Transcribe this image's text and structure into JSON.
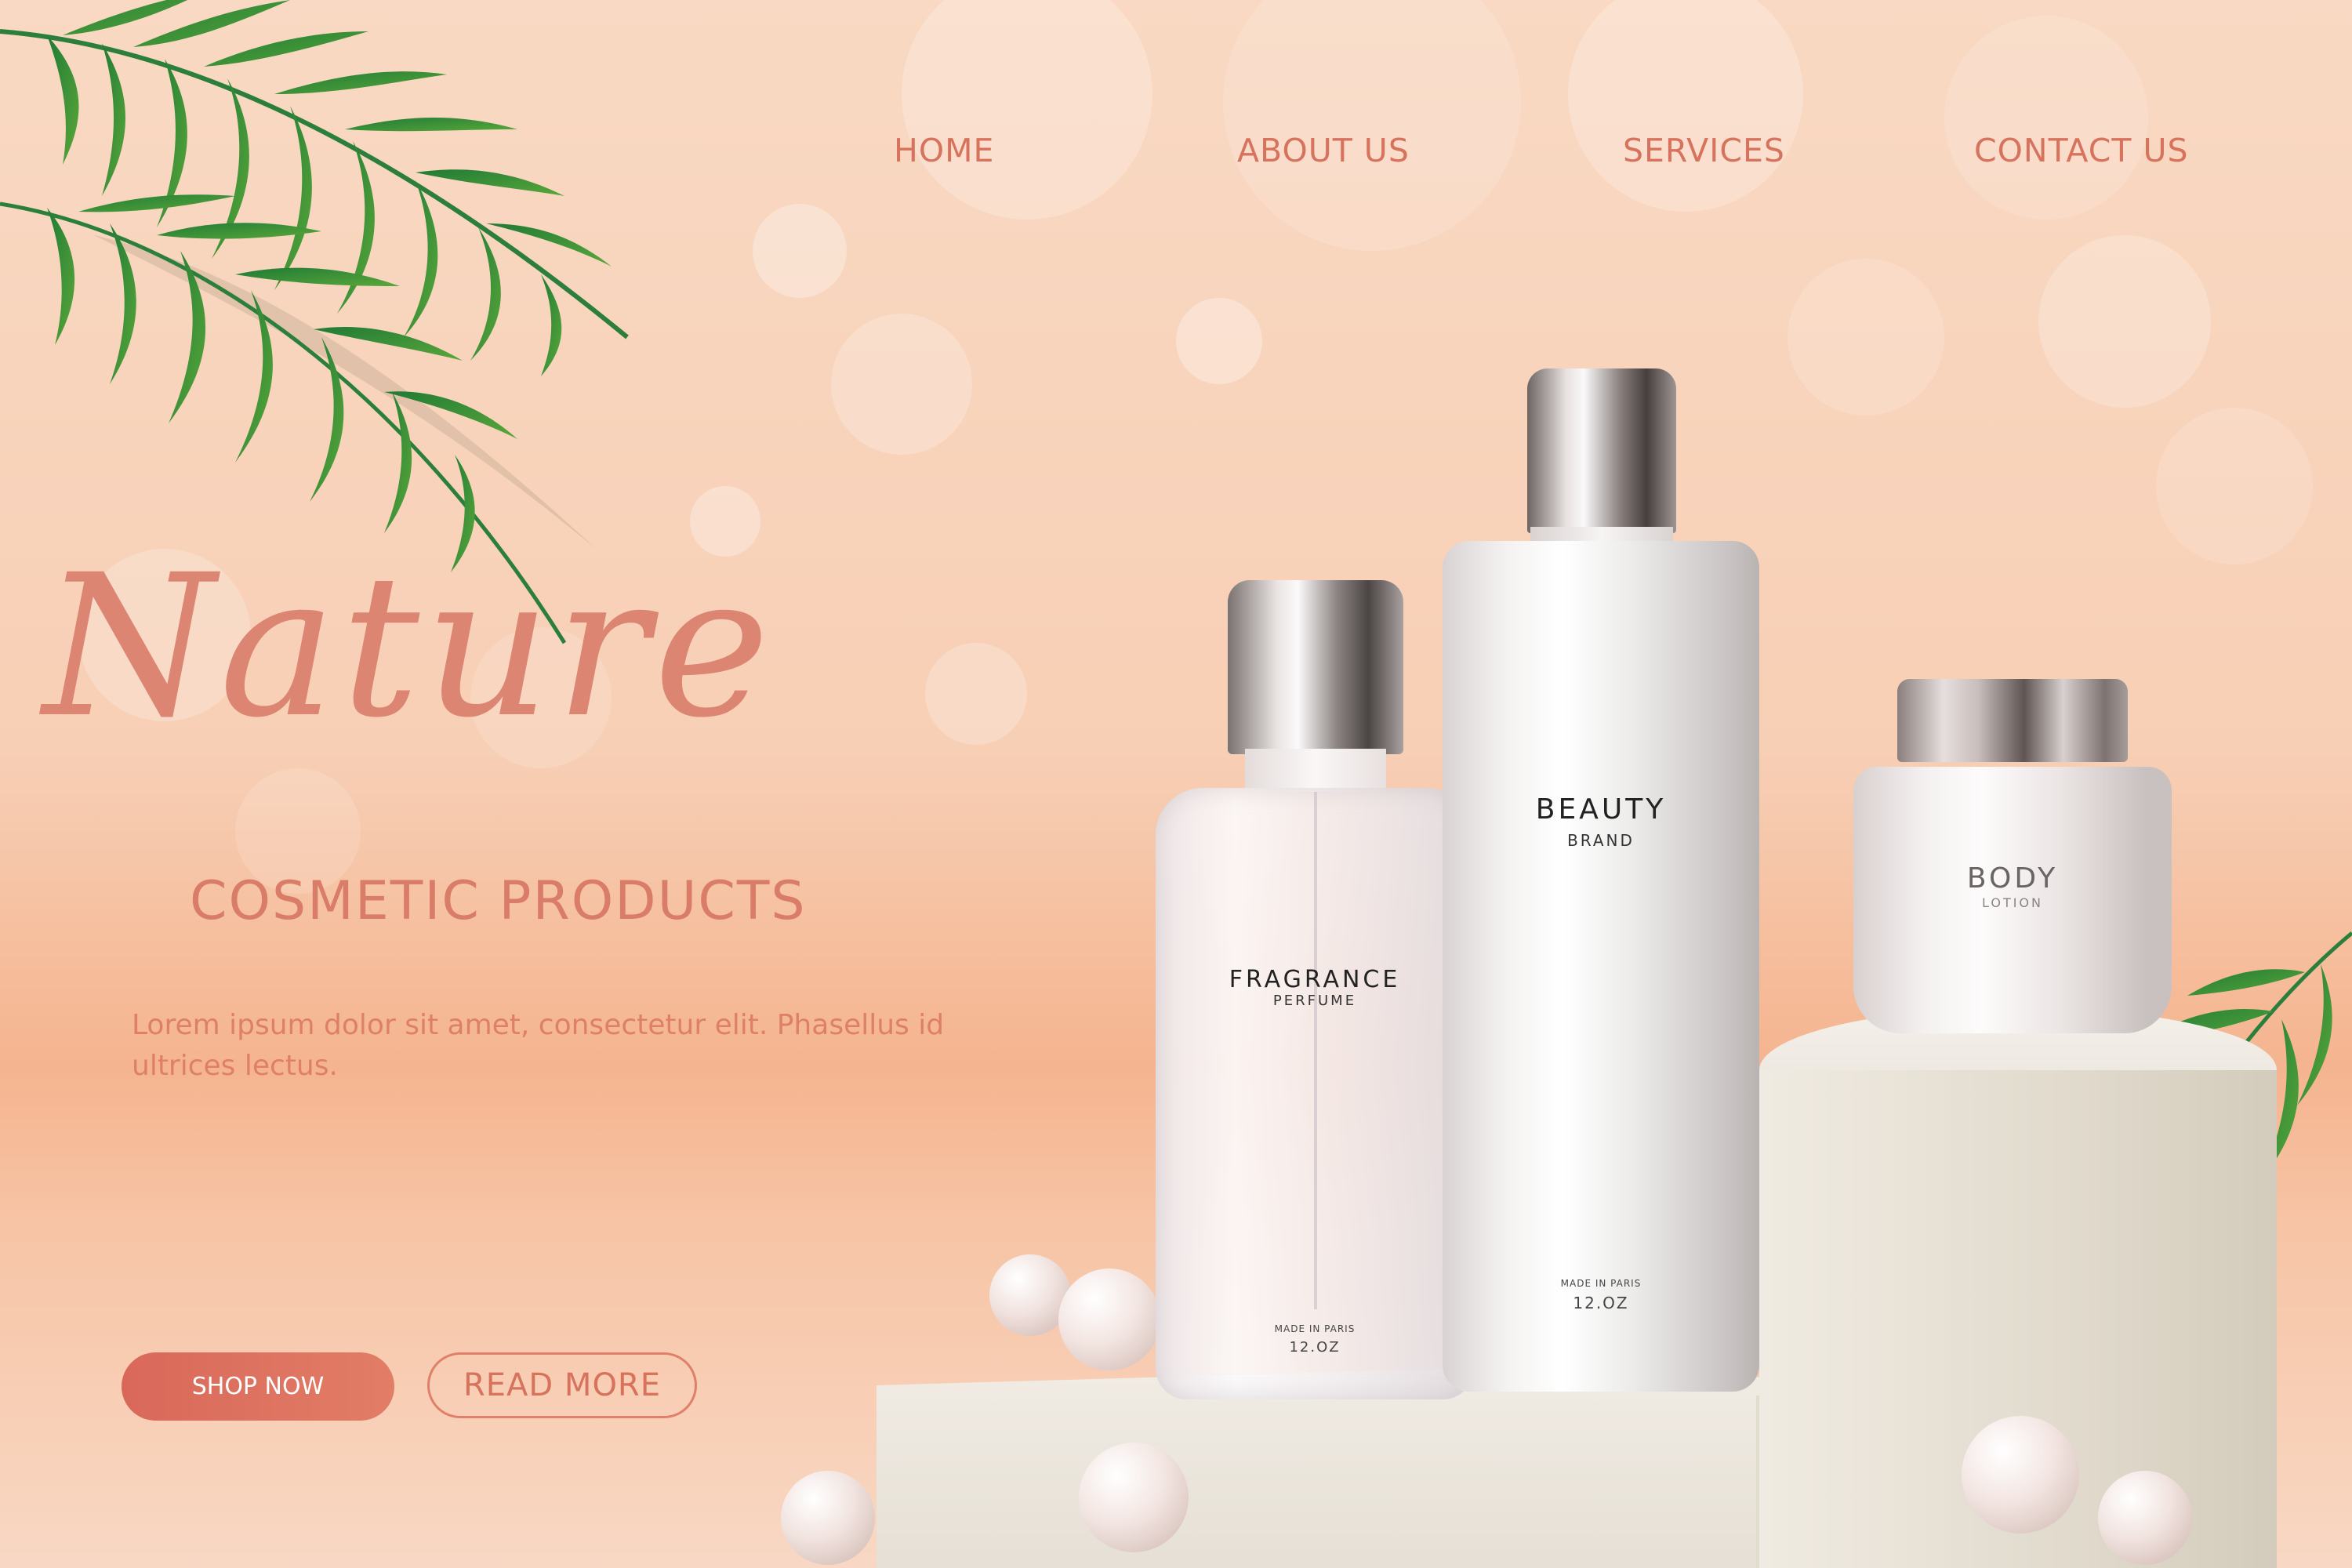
{
  "nav": {
    "home": "HOME",
    "about": "ABOUT US",
    "services": "SERVICES",
    "contact": "CONTACT US"
  },
  "hero": {
    "script_title": "Nature",
    "subtitle": "COSMETIC PRODUCTS",
    "description": "Lorem ipsum dolor sit amet, consectetur elit. Phasellus id ultrices lectus.",
    "shop_button": "SHOP NOW",
    "read_button": "READ MORE"
  },
  "products": {
    "fragrance": {
      "name": "FRAGRANCE",
      "type": "PERFUME",
      "origin": "MADE IN PARIS",
      "size": "12.OZ"
    },
    "beauty": {
      "name": "BEAUTY",
      "type": "BRAND",
      "origin": "MADE IN PARIS",
      "size": "12.OZ"
    },
    "body": {
      "name": "BODY",
      "type": "LOTION"
    }
  },
  "colors": {
    "accent": "#d7725d",
    "background": "#f8d4bd",
    "leaf": "#2e8b3a"
  },
  "icons": [
    "palm-leaf-icon",
    "pearl-icon"
  ]
}
